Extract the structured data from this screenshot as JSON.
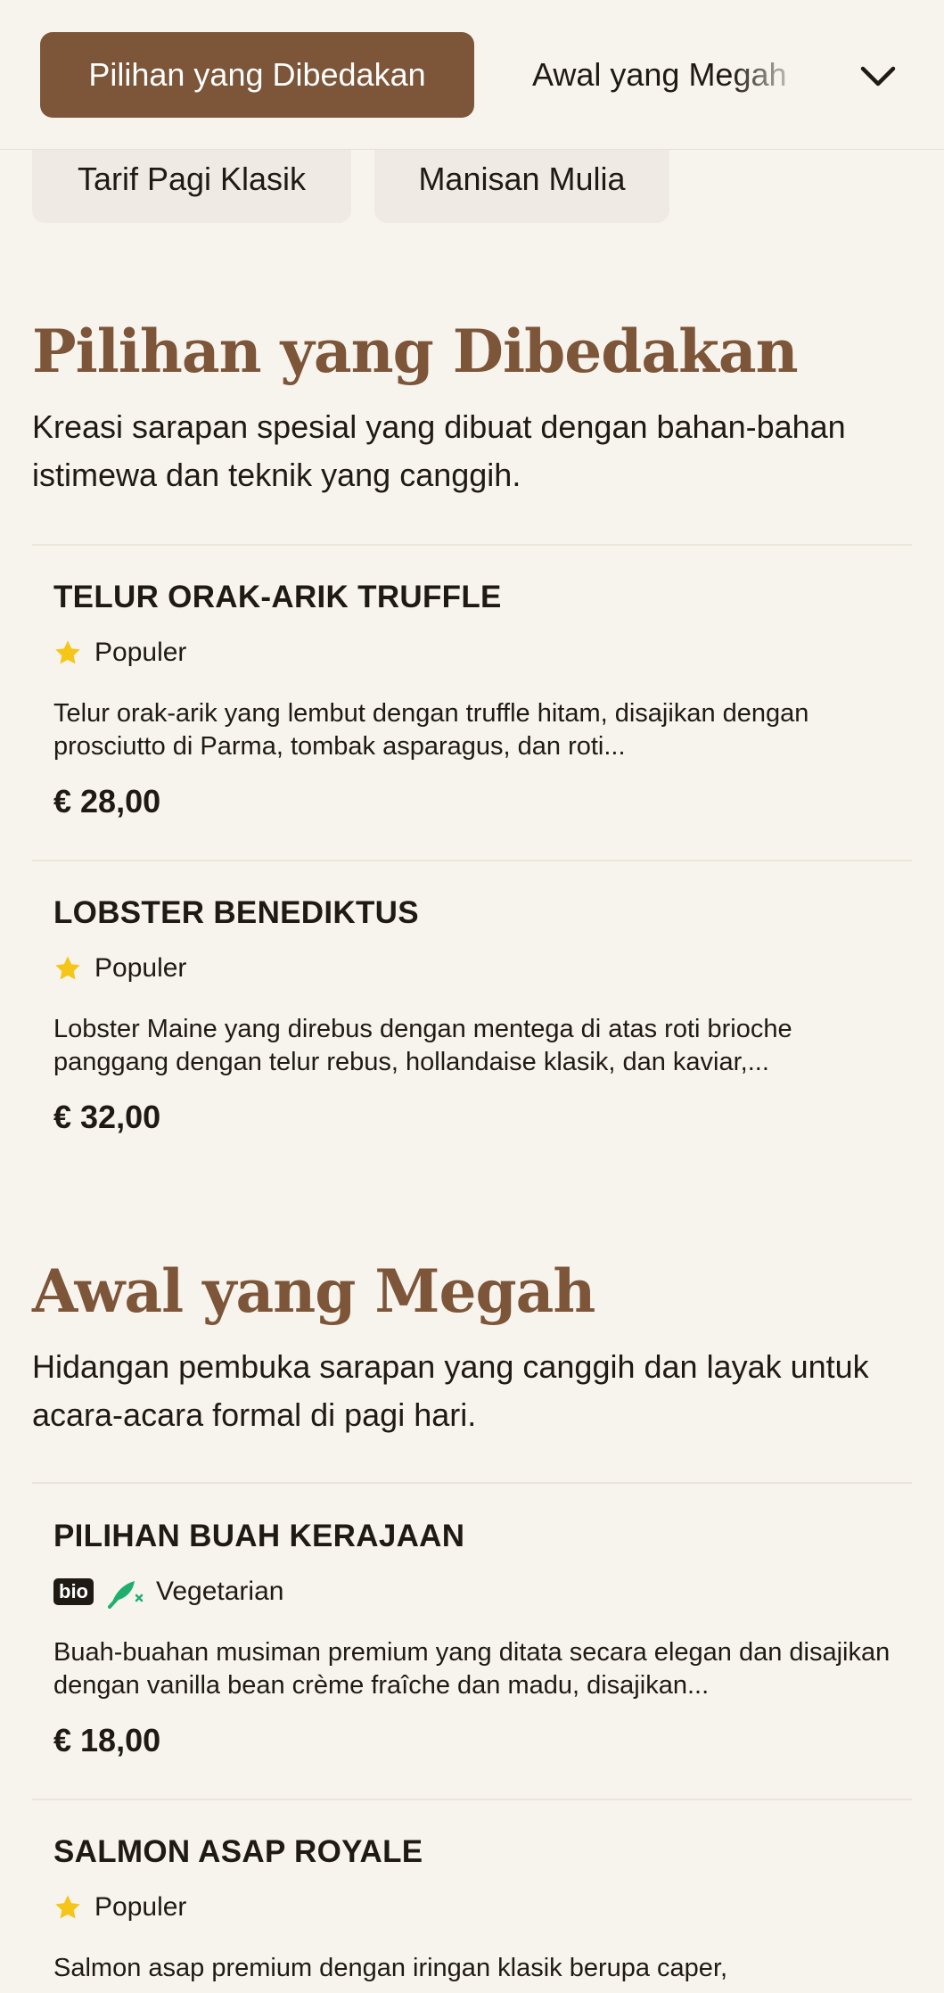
{
  "nav": {
    "active_tab": "Pilihan yang Dibedakan",
    "next_tab": "Awal yang Megah",
    "expand_icon": "chevron-down-icon",
    "secondary_tabs": [
      "Tarif Pagi Klasik",
      "Manisan Mulia"
    ]
  },
  "sections": [
    {
      "title": "Pilihan yang Dibedakan",
      "description": "Kreasi sarapan spesial yang dibuat dengan bahan-bahan istimewa dan teknik yang canggih.",
      "items": [
        {
          "name": "TELUR ORAK-ARIK TRUFFLE",
          "badge": "Populer",
          "description": "Telur orak-arik yang lembut dengan truffle hitam, disajikan dengan prosciutto di Parma, tombak asparagus, dan roti...",
          "price": "€ 28,00"
        },
        {
          "name": "LOBSTER BENEDIKTUS",
          "badge": "Populer",
          "description": "Lobster Maine yang direbus dengan mentega di atas roti brioche panggang dengan telur rebus, hollandaise klasik, dan kaviar,...",
          "price": "€ 32,00"
        }
      ]
    },
    {
      "title": "Awal yang Megah",
      "description": "Hidangan pembuka sarapan yang canggih dan layak untuk acara-acara formal di pagi hari.",
      "items": [
        {
          "name": "PILIHAN BUAH KERAJAAN",
          "bio_label": "bio",
          "badge": "Vegetarian",
          "description": "Buah-buahan musiman premium yang ditata secara elegan dan disajikan dengan vanilla bean crème fraîche dan madu, disajikan...",
          "price": "€ 18,00"
        },
        {
          "name": "SALMON ASAP ROYALE",
          "badge": "Populer",
          "description": "Salmon asap premium dengan iringan klasik berupa caper,"
        }
      ]
    }
  ],
  "colors": {
    "accent": "#7d5538",
    "background": "#f7f4ee",
    "star": "#f5c518",
    "vegetarian": "#1fae6e"
  }
}
